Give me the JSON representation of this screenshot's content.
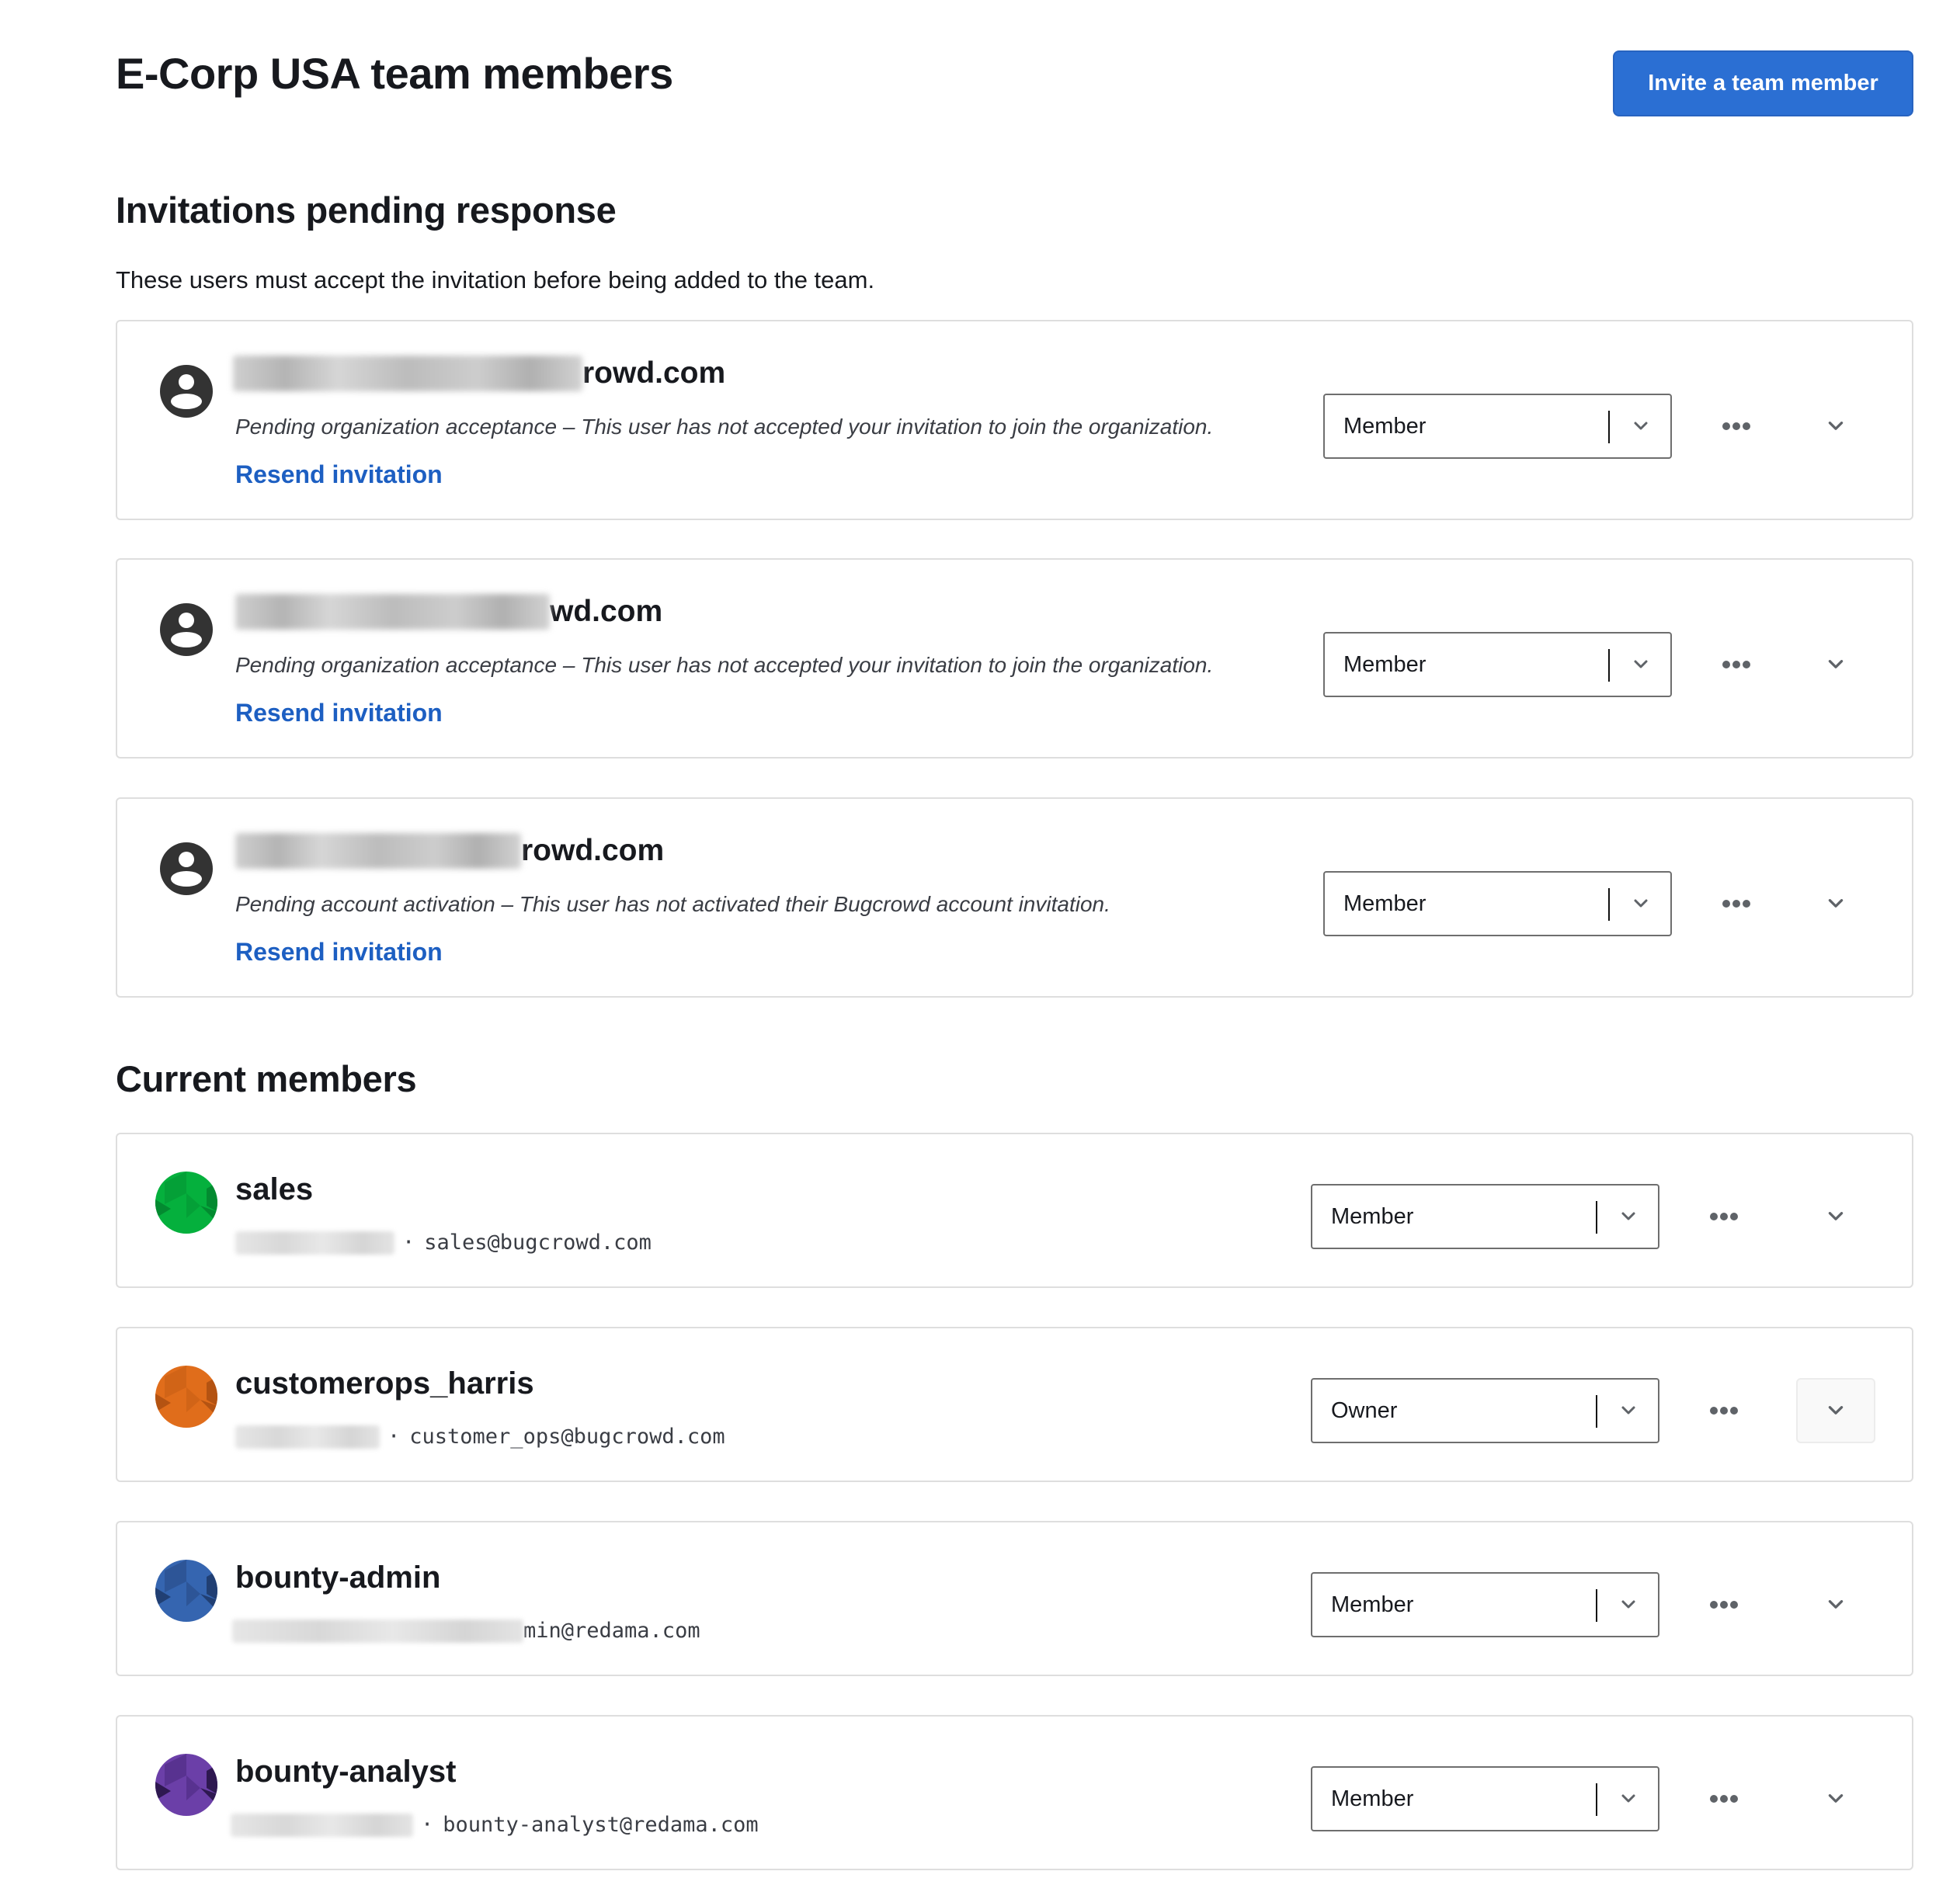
{
  "page": {
    "title": "E-Corp USA team members",
    "invite_button_label": "Invite a team member"
  },
  "colors": {
    "primary": "#2b6fd3",
    "link": "#1d5fc2",
    "text": "#17191e",
    "border": "#dedede"
  },
  "pending": {
    "title": "Invitations pending response",
    "description": "These users must accept the invitation before being added to the team.",
    "items": [
      {
        "email_visible_suffix": "rowd.com",
        "status": "Pending organization acceptance – This user has not accepted your invitation to join the organization.",
        "action_label": "Resend invitation",
        "role": "Member",
        "avatar_icon": "user-circle-icon"
      },
      {
        "email_visible_suffix": "wd.com",
        "status": "Pending organization acceptance – This user has not accepted your invitation to join the organization.",
        "action_label": "Resend invitation",
        "role": "Member",
        "avatar_icon": "user-circle-icon"
      },
      {
        "email_visible_suffix": "rowd.com",
        "status": "Pending account activation – This user has not activated their Bugcrowd account invitation.",
        "action_label": "Resend invitation",
        "role": "Member",
        "avatar_icon": "user-circle-icon"
      }
    ]
  },
  "members": {
    "title": "Current members",
    "items": [
      {
        "username": "sales",
        "email": "sales@bugcrowd.com",
        "separator": "·",
        "role": "Member",
        "avatar_color": "#05b03d",
        "avatar_dark": "#038a30",
        "avatar_mid": "#04a037",
        "expanded": false
      },
      {
        "username": "customerops_harris",
        "email": "customer_ops@bugcrowd.com",
        "separator": "·",
        "role": "Owner",
        "avatar_color": "#e06d1b",
        "avatar_dark": "#b45312",
        "avatar_mid": "#d16417",
        "expanded": true
      },
      {
        "username": "bounty-admin",
        "email": "min@redama.com",
        "separator": "",
        "role": "Member",
        "avatar_color": "#3565b0",
        "avatar_dark": "#213f73",
        "avatar_mid": "#2d5597",
        "expanded": false
      },
      {
        "username": "bounty-analyst",
        "email": "bounty-analyst@redama.com",
        "separator": "·",
        "role": "Member",
        "avatar_color": "#6b3fa8",
        "avatar_dark": "#2e1850",
        "avatar_mid": "#583290",
        "expanded": false
      }
    ]
  }
}
